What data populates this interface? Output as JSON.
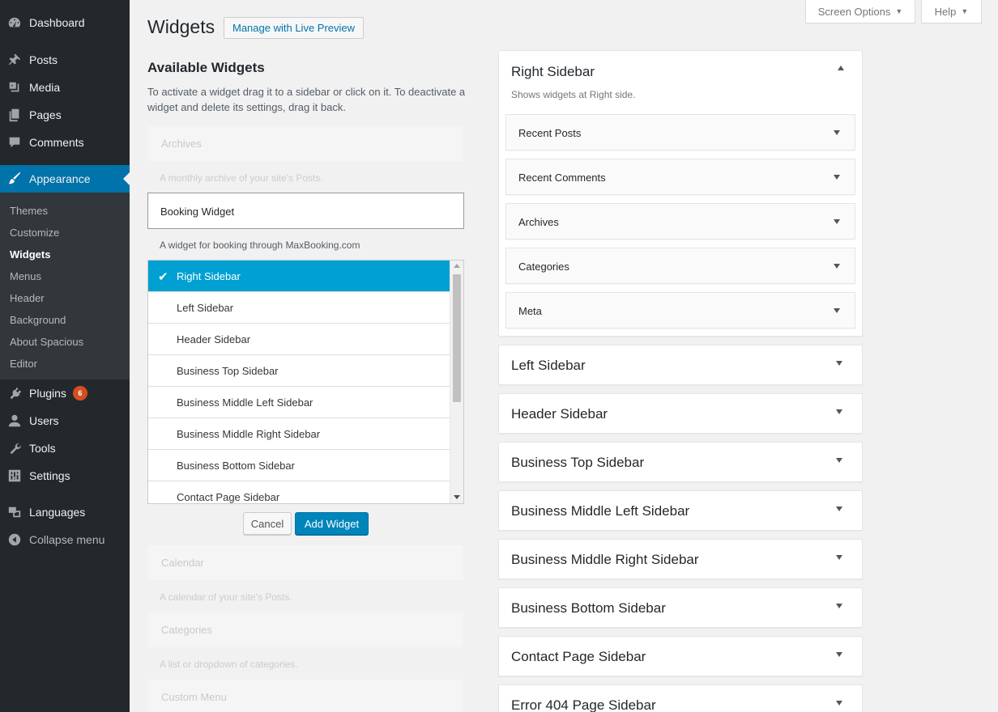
{
  "menu": {
    "items": [
      {
        "label": "Dashboard"
      },
      {
        "label": "Posts"
      },
      {
        "label": "Media"
      },
      {
        "label": "Pages"
      },
      {
        "label": "Comments"
      },
      {
        "label": "Appearance"
      },
      {
        "label": "Plugins",
        "badge": "6"
      },
      {
        "label": "Users"
      },
      {
        "label": "Tools"
      },
      {
        "label": "Settings"
      },
      {
        "label": "Languages"
      },
      {
        "label": "Collapse menu"
      }
    ],
    "submenu": [
      "Themes",
      "Customize",
      "Widgets",
      "Menus",
      "Header",
      "Background",
      "About Spacious",
      "Editor"
    ]
  },
  "tabs": {
    "screen_options": "Screen Options",
    "help": "Help"
  },
  "page": {
    "title": "Widgets",
    "live_preview": "Manage with Live Preview",
    "available_title": "Available Widgets",
    "available_desc": "To activate a widget drag it to a sidebar or click on it. To deactivate a widget and delete its settings, drag it back."
  },
  "available": {
    "archives": {
      "title": "Archives",
      "desc": "A monthly archive of your site's Posts."
    },
    "booking": {
      "title": "Booking Widget",
      "desc": "A widget for booking through MaxBooking.com"
    },
    "calendar": {
      "title": "Calendar",
      "desc": "A calendar of your site's Posts."
    },
    "categories": {
      "title": "Categories",
      "desc": "A list or dropdown of categories."
    },
    "custom_menu": {
      "title": "Custom Menu"
    }
  },
  "chooser": {
    "items": [
      "Right Sidebar",
      "Left Sidebar",
      "Header Sidebar",
      "Business Top Sidebar",
      "Business Middle Left Sidebar",
      "Business Middle Right Sidebar",
      "Business Bottom Sidebar",
      "Contact Page Sidebar"
    ],
    "cancel": "Cancel",
    "add": "Add Widget"
  },
  "right_sidebar": {
    "title": "Right Sidebar",
    "desc": "Shows widgets at Right side.",
    "widgets": [
      "Recent Posts",
      "Recent Comments",
      "Archives",
      "Categories",
      "Meta"
    ]
  },
  "sidebars": [
    "Left Sidebar",
    "Header Sidebar",
    "Business Top Sidebar",
    "Business Middle Left Sidebar",
    "Business Middle Right Sidebar",
    "Business Bottom Sidebar",
    "Contact Page Sidebar",
    "Error 404 Page Sidebar"
  ]
}
